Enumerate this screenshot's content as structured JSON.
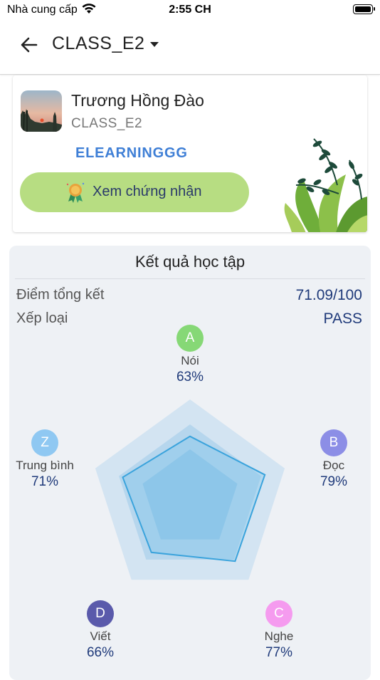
{
  "status_bar": {
    "carrier": "Nhà cung cấp",
    "time": "2:55 CH"
  },
  "nav": {
    "title": "CLASS_E2"
  },
  "profile": {
    "name": "Trương Hồng Đào",
    "class": "CLASS_E2",
    "org": "ELEARNINGGG",
    "certificate_button": "Xem chứng nhận"
  },
  "results": {
    "title": "Kết quả học tập",
    "score_label": "Điểm tổng kết",
    "score_value": "71.09/100",
    "rank_label": "Xếp loại",
    "rank_value": "PASS",
    "skills": [
      {
        "badge": "A",
        "name": "Nói",
        "percent": "63%",
        "value": 63,
        "color": "#86d876"
      },
      {
        "badge": "B",
        "name": "Đọc",
        "percent": "79%",
        "value": 79,
        "color": "#8c8ee6"
      },
      {
        "badge": "C",
        "name": "Nghe",
        "percent": "77%",
        "value": 77,
        "color": "#f59bef"
      },
      {
        "badge": "D",
        "name": "Viết",
        "percent": "66%",
        "value": 66,
        "color": "#5a5aab"
      },
      {
        "badge": "Z",
        "name": "Trung bình",
        "percent": "71%",
        "value": 71,
        "color": "#8fc8f2"
      }
    ]
  }
}
